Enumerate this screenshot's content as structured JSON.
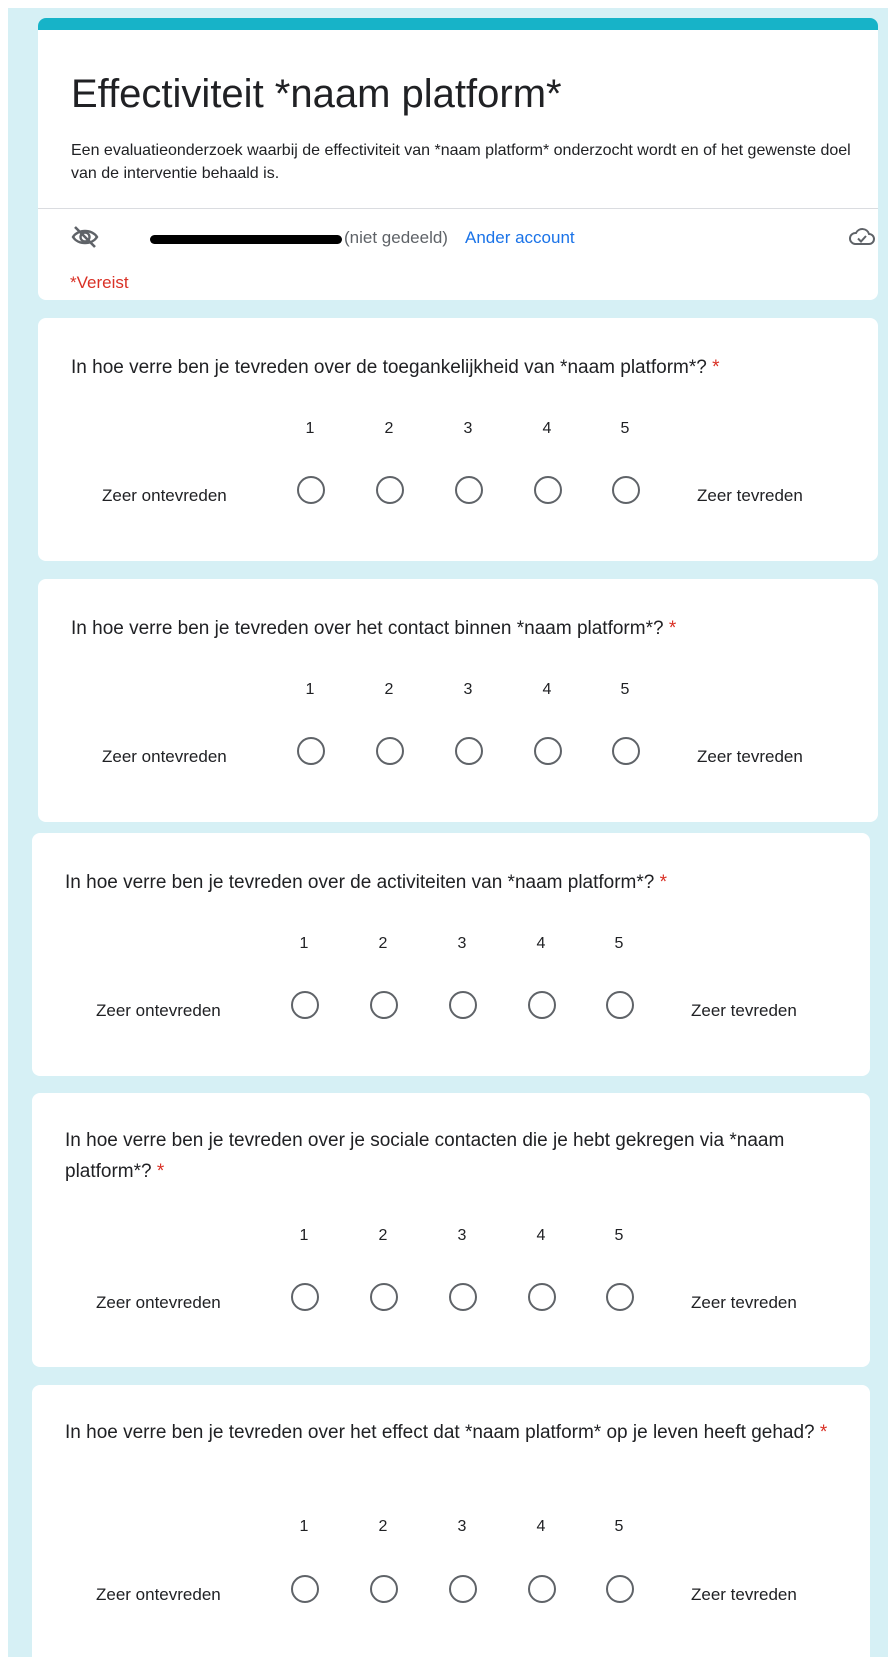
{
  "form": {
    "title": "Effectiviteit *naam platform*",
    "description": "Een evaluatieonderzoek waarbij de effectiviteit van *naam platform* onderzocht wordt en of het gewenste doel van de interventie behaald is.",
    "account_status": "(niet gedeeld)",
    "switch_account": "Ander account",
    "required_note": "*Vereist",
    "accent_color": "#17b3c8",
    "required_color": "#d93025",
    "link_color": "#1a73e8"
  },
  "scale": {
    "numbers": [
      "1",
      "2",
      "3",
      "4",
      "5"
    ],
    "low_label": "Zeer ontevreden",
    "high_label": "Zeer tevreden"
  },
  "questions": [
    {
      "text": "In hoe verre ben je tevreden over de toegankelijkheid van *naam platform*?",
      "required_mark": "*"
    },
    {
      "text": "In hoe verre ben je tevreden over het contact binnen *naam platform*?",
      "required_mark": "*"
    },
    {
      "text": "In hoe verre ben je tevreden over de activiteiten van *naam platform*?",
      "required_mark": "*"
    },
    {
      "text": "In hoe verre ben je tevreden over je sociale contacten die je hebt gekregen via *naam platform*?",
      "required_mark": "*"
    },
    {
      "text": "In hoe verre ben je tevreden over het effect dat *naam platform* op je leven heeft gehad?",
      "required_mark": "*"
    }
  ],
  "icons": {
    "visibility": "eye-off-icon",
    "save_status": "cloud-check-icon"
  }
}
